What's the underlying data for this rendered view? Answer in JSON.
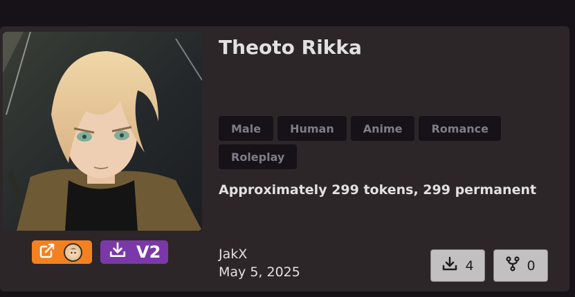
{
  "character": {
    "name": "Theoto Rikka",
    "tags": [
      "Male",
      "Human",
      "Anime",
      "Romance",
      "Roleplay"
    ],
    "tokens_text": "Approximately 299 tokens, 299 permanent",
    "author": "JakX",
    "date": "May 5, 2025"
  },
  "actions": {
    "external_icon": "external-link-icon",
    "download_icon": "download-icon",
    "download_format": "V2"
  },
  "stats": {
    "downloads": "4",
    "forks": "0",
    "download_icon": "download-icon",
    "fork_icon": "fork-icon"
  },
  "colors": {
    "background": "#161217",
    "card": "#2c2629",
    "tag_bg": "#161217",
    "tag_text": "#7e7d8a",
    "external_button": "#f4811f",
    "format_button": "#7b38a8",
    "stat_button": "#c3c0c2"
  }
}
